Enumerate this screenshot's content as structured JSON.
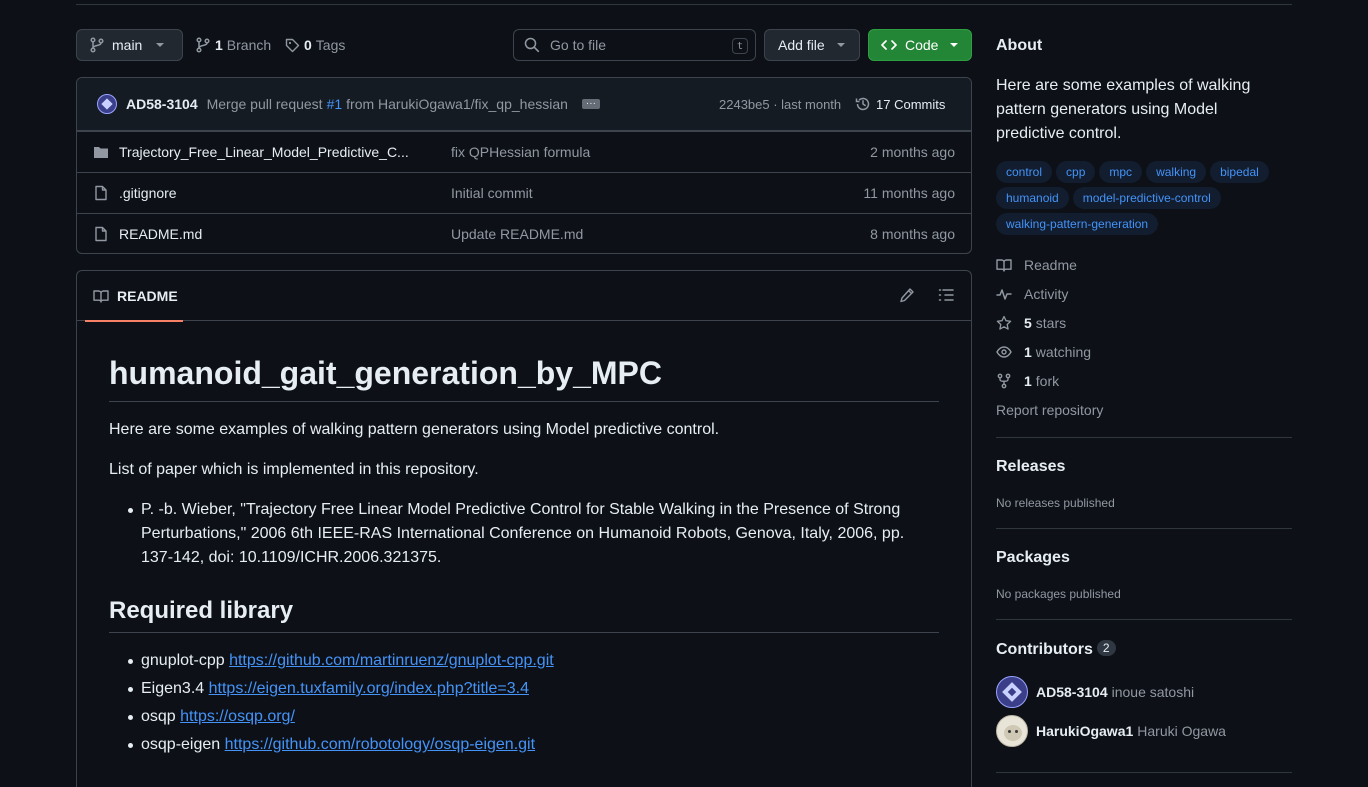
{
  "toolbar": {
    "branch_name": "main",
    "branch_count": "1",
    "branch_label": "Branch",
    "tag_count": "0",
    "tag_label": "Tags",
    "search_placeholder": "Go to file",
    "search_shortcut": "t",
    "add_file_label": "Add file",
    "code_label": "Code"
  },
  "commit": {
    "author": "AD58-3104",
    "message_prefix": "Merge pull request",
    "pr_link": "#1",
    "message_suffix": "from HarukiOgawa1/fix_qp_hessian",
    "hash_time": "2243be5 · last month",
    "commits_count": "17 Commits"
  },
  "files": [
    {
      "name": "Trajectory_Free_Linear_Model_Predictive_C...",
      "message": "fix QPHessian formula",
      "date": "2 months ago",
      "type": "folder"
    },
    {
      "name": ".gitignore",
      "message": "Initial commit",
      "date": "11 months ago",
      "type": "file"
    },
    {
      "name": "README.md",
      "message": "Update README.md",
      "date": "8 months ago",
      "type": "file"
    }
  ],
  "readme": {
    "tab_label": "README",
    "title": "humanoid_gait_generation_by_MPC",
    "intro": "Here are some examples of walking pattern generators using Model predictive control.",
    "papers_intro": "List of paper which is implemented in this repository.",
    "papers": [
      "P. -b. Wieber, \"Trajectory Free Linear Model Predictive Control for Stable Walking in the Presence of Strong Perturbations,\" 2006 6th IEEE-RAS International Conference on Humanoid Robots, Genova, Italy, 2006, pp. 137-142, doi: 10.1109/ICHR.2006.321375."
    ],
    "required_heading": "Required library",
    "libraries": [
      {
        "name": "gnuplot-cpp",
        "url": "https://github.com/martinruenz/gnuplot-cpp.git"
      },
      {
        "name": "Eigen3.4",
        "url": "https://eigen.tuxfamily.org/index.php?title=3.4"
      },
      {
        "name": "osqp",
        "url": "https://osqp.org/"
      },
      {
        "name": "osqp-eigen",
        "url": "https://github.com/robotology/osqp-eigen.git"
      }
    ]
  },
  "about": {
    "heading": "About",
    "description": "Here are some examples of walking pattern generators using Model predictive control.",
    "topics": [
      "control",
      "cpp",
      "mpc",
      "walking",
      "bipedal",
      "humanoid",
      "model-predictive-control",
      "walking-pattern-generation"
    ],
    "readme_label": "Readme",
    "activity_label": "Activity",
    "stars_count": "5",
    "stars_label": "stars",
    "watching_count": "1",
    "watching_label": "watching",
    "fork_count": "1",
    "fork_label": "fork",
    "report_label": "Report repository"
  },
  "releases": {
    "heading": "Releases",
    "empty": "No releases published"
  },
  "packages": {
    "heading": "Packages",
    "empty": "No packages published"
  },
  "contributors": {
    "heading": "Contributors",
    "count": "2",
    "people": [
      {
        "login": "AD58-3104",
        "name": "inoue satoshi"
      },
      {
        "login": "HarukiOgawa1",
        "name": "Haruki Ogawa"
      }
    ]
  },
  "colors": {
    "accent": "#4493f8",
    "primary_button": "#238636",
    "background": "#0d1117",
    "tab_underline": "#f78166"
  }
}
